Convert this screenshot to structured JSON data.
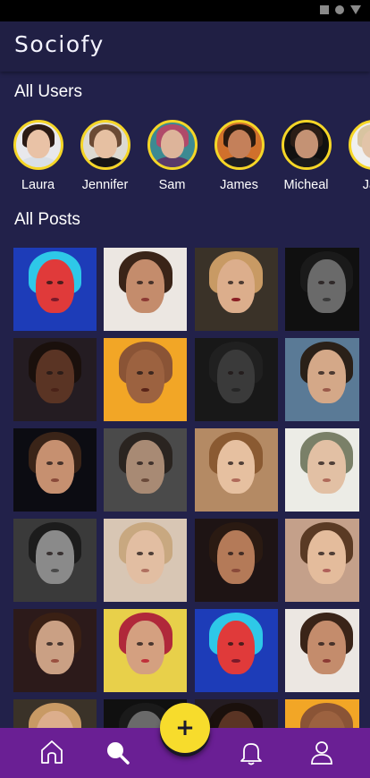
{
  "app": {
    "title": "Sociofy"
  },
  "status_bar": {
    "icons": [
      "square-icon",
      "circle-icon",
      "triangle-icon"
    ]
  },
  "sections": {
    "users_title": "All Users",
    "posts_title": "All Posts"
  },
  "users": [
    {
      "name": "Laura",
      "skin": "#e9c2a6",
      "hair": "#2b1a14",
      "shirt": "#d9dfe6",
      "bg": "#e8e8ec"
    },
    {
      "name": "Jennifer",
      "skin": "#e6c0a2",
      "hair": "#6b4a34",
      "shirt": "#151515",
      "bg": "#dcdad2"
    },
    {
      "name": "Sam",
      "skin": "#ddb49a",
      "hair": "#b04a6a",
      "shirt": "#5a3a6a",
      "bg": "#3c8a92"
    },
    {
      "name": "James",
      "skin": "#c4805a",
      "hair": "#2a1a10",
      "shirt": "#1e1e22",
      "bg": "#d0702c"
    },
    {
      "name": "Micheal",
      "skin": "#c49274",
      "hair": "#2a1d16",
      "shirt": "#1b1b1b",
      "bg": "#101010"
    },
    {
      "name": "Jan",
      "skin": "#e2c4a8",
      "hair": "#d8c4a0",
      "shirt": "#efefef",
      "bg": "#efefef"
    }
  ],
  "posts": [
    {
      "bg": "#1d3cb8",
      "skin": "#e03a3a",
      "hair": "#2ec8e8",
      "lips": "#7a1a2a"
    },
    {
      "bg": "#ece7e2",
      "skin": "#c48c6c",
      "hair": "#3a2418",
      "lips": "#8c3a34"
    },
    {
      "bg": "#3a3228",
      "skin": "#dcae8c",
      "hair": "#c89a64",
      "lips": "#8a1f24"
    },
    {
      "bg": "#101010",
      "skin": "#6a6a6a",
      "hair": "#1a1a1a",
      "lips": "#3a3a3a"
    },
    {
      "bg": "#241c22",
      "skin": "#5a3424",
      "hair": "#1a100c",
      "lips": "#4a2218"
    },
    {
      "bg": "#f2a626",
      "skin": "#9c6240",
      "hair": "#8a5436",
      "lips": "#5a2418"
    },
    {
      "bg": "#181818",
      "skin": "#3a3a3a",
      "hair": "#202020",
      "lips": "#262626"
    },
    {
      "bg": "#5a7a96",
      "skin": "#d4a888",
      "hair": "#2a2018",
      "lips": "#9a5a4a"
    },
    {
      "bg": "#0c0c12",
      "skin": "#c69070",
      "hair": "#3a2418",
      "lips": "#8a4a3a"
    },
    {
      "bg": "#4a4a4a",
      "skin": "#a88a74",
      "hair": "#2a2420",
      "lips": "#6a4a3a"
    },
    {
      "bg": "#b48a64",
      "skin": "#e6c0a0",
      "hair": "#8a5a32",
      "lips": "#b06a5a"
    },
    {
      "bg": "#ecece6",
      "skin": "#e2c0a4",
      "hair": "#7a8068",
      "lips": "#b06a5a"
    },
    {
      "bg": "#3a3a3a",
      "skin": "#8a8a8a",
      "hair": "#1c1c1c",
      "lips": "#4a4a4a"
    },
    {
      "bg": "#d8c6b4",
      "skin": "#e2bea2",
      "hair": "#c8a880",
      "lips": "#b07060"
    },
    {
      "bg": "#1e1414",
      "skin": "#b47a58",
      "hair": "#2a1a12",
      "lips": "#8a4a3a"
    },
    {
      "bg": "#c4a08a",
      "skin": "#e4bc9c",
      "hair": "#5a3a24",
      "lips": "#b0605a"
    },
    {
      "bg": "#2c1a1a",
      "skin": "#caa084",
      "hair": "#3a2014",
      "lips": "#9a5040"
    },
    {
      "bg": "#e8d04a",
      "skin": "#d4a080",
      "hair": "#b0283a",
      "lips": "#c0303a"
    },
    {
      "bg": "#1d3cb8",
      "skin": "#e03a3a",
      "hair": "#2ec8e8",
      "lips": "#7a1a2a"
    },
    {
      "bg": "#ece7e2",
      "skin": "#c48c6c",
      "hair": "#3a2418",
      "lips": "#8c3a34"
    },
    {
      "bg": "#3a3228",
      "skin": "#dcae8c",
      "hair": "#c89a64",
      "lips": "#8a1f24"
    },
    {
      "bg": "#101010",
      "skin": "#6a6a6a",
      "hair": "#1a1a1a",
      "lips": "#3a3a3a"
    },
    {
      "bg": "#241c22",
      "skin": "#5a3424",
      "hair": "#1a100c",
      "lips": "#4a2218"
    },
    {
      "bg": "#f2a626",
      "skin": "#9c6240",
      "hair": "#8a5436",
      "lips": "#5a2418"
    }
  ],
  "fab": {
    "label": "+"
  },
  "bottom_nav": {
    "items": [
      {
        "name": "home-icon"
      },
      {
        "name": "search-icon"
      },
      {
        "name": "bell-icon"
      },
      {
        "name": "profile-icon"
      }
    ]
  },
  "colors": {
    "background": "#22214a",
    "app_bar": "#201f44",
    "accent": "#f7dc2c",
    "bottom_nav": "#6a1f94"
  }
}
